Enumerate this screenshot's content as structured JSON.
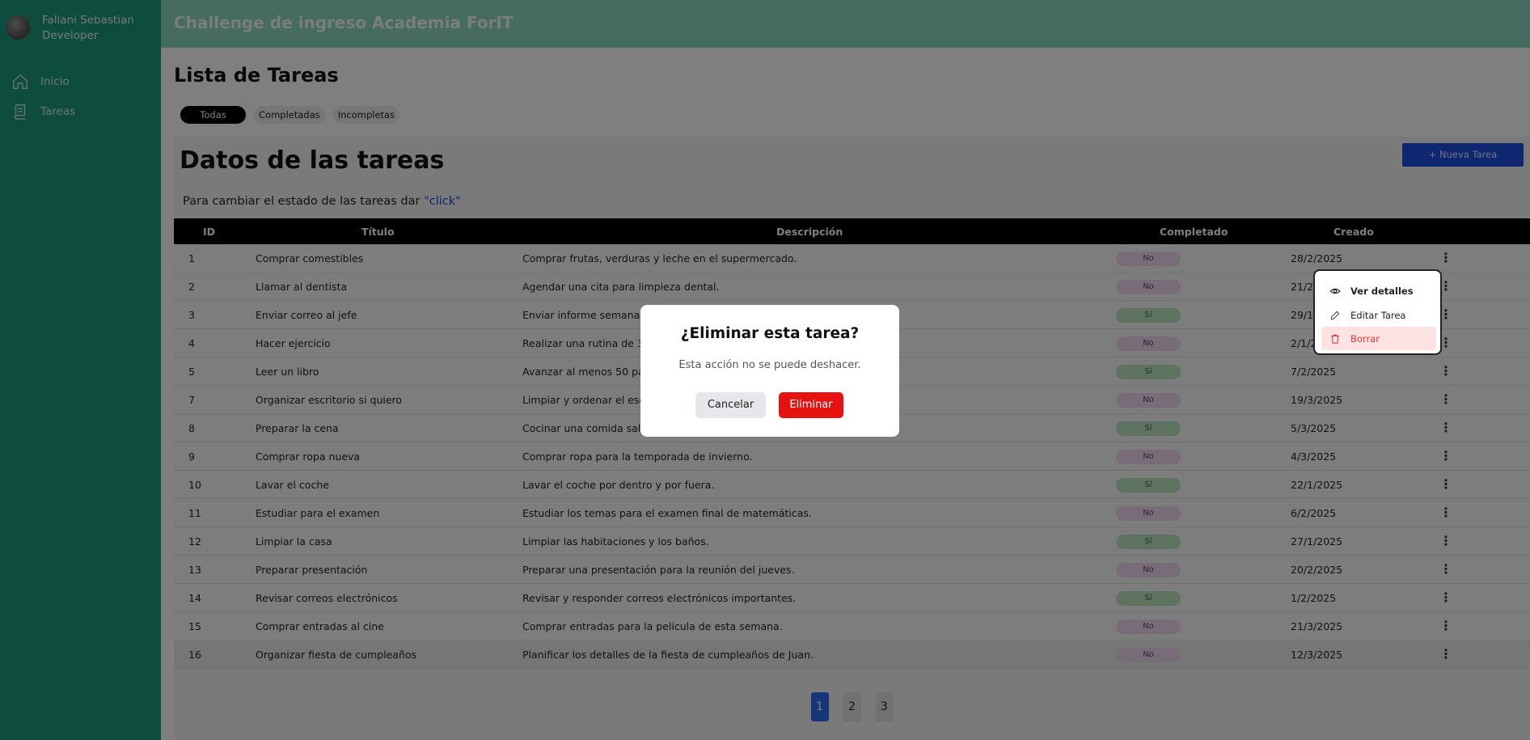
{
  "sidebar": {
    "user_name": "Faliani Sebastian",
    "user_role": "Developer",
    "items": [
      {
        "label": "Inicio",
        "icon": "home-icon"
      },
      {
        "label": "Tareas",
        "icon": "document-icon"
      }
    ]
  },
  "header": {
    "title": "Challenge de ingreso Academia ForIT"
  },
  "page": {
    "title": "Lista de Tareas",
    "filters": [
      "Todas",
      "Completadas",
      "Incompletas"
    ]
  },
  "panel": {
    "title": "Datos de las tareas",
    "new_button": "+ Nueva Tarea",
    "hint_text": "Para cambiar el estado de las tareas dar ",
    "hint_highlight": "\"click\""
  },
  "table": {
    "headers": [
      "ID",
      "Título",
      "Descripción",
      "Completado",
      "Creado"
    ],
    "rows": [
      {
        "id": "1",
        "title": "Comprar comestibles",
        "desc": "Comprar frutas, verduras y leche en el supermercado.",
        "status": "No",
        "date": "28/2/2025"
      },
      {
        "id": "2",
        "title": "Llamar al dentista",
        "desc": "Agendar una cita para limpieza dental.",
        "status": "No",
        "date": "21/2/2025"
      },
      {
        "id": "3",
        "title": "Enviar correo al jefe",
        "desc": "Enviar informe semanal",
        "status": "Sí",
        "date": "29/1/2025"
      },
      {
        "id": "4",
        "title": "Hacer ejercicio",
        "desc": "Realizar una rutina de 30",
        "status": "No",
        "date": "2/1/2025"
      },
      {
        "id": "5",
        "title": "Leer un libro",
        "desc": "Avanzar al menos 50 pá",
        "status": "Sí",
        "date": "7/2/2025"
      },
      {
        "id": "7",
        "title": "Organizar escritorio si quiero",
        "desc": "Limpiar y ordenar el escr",
        "status": "No",
        "date": "19/3/2025"
      },
      {
        "id": "8",
        "title": "Preparar la cena",
        "desc": "Cocinar una comida saludable para la familia.",
        "status": "Sí",
        "date": "5/3/2025"
      },
      {
        "id": "9",
        "title": "Comprar ropa nueva",
        "desc": "Comprar ropa para la temporada de invierno.",
        "status": "No",
        "date": "4/3/2025"
      },
      {
        "id": "10",
        "title": "Lavar el coche",
        "desc": "Lavar el coche por dentro y por fuera.",
        "status": "Sí",
        "date": "22/1/2025"
      },
      {
        "id": "11",
        "title": "Estudiar para el examen",
        "desc": "Estudiar los temas para el examen final de matemáticas.",
        "status": "No",
        "date": "6/2/2025"
      },
      {
        "id": "12",
        "title": "Limpiar la casa",
        "desc": "Limpiar las habitaciones y los baños.",
        "status": "Sí",
        "date": "27/1/2025"
      },
      {
        "id": "13",
        "title": "Preparar presentación",
        "desc": "Preparar una presentación para la reunión del jueves.",
        "status": "No",
        "date": "20/2/2025"
      },
      {
        "id": "14",
        "title": "Revisar correos electrónicos",
        "desc": "Revisar y responder correos electrónicos importantes.",
        "status": "Sí",
        "date": "1/2/2025"
      },
      {
        "id": "15",
        "title": "Comprar entradas al cine",
        "desc": "Comprar entradas para la película de esta semana.",
        "status": "No",
        "date": "21/3/2025"
      },
      {
        "id": "16",
        "title": "Organizar fiesta de cumpleaños",
        "desc": "Planificar los detalles de la fiesta de cumpleaños de Juan.",
        "status": "No",
        "date": "12/3/2025"
      }
    ]
  },
  "pagination": [
    "1",
    "2",
    "3"
  ],
  "context_menu": {
    "view": "Ver detalles",
    "edit": "Editar Tarea",
    "delete": "Borrar"
  },
  "modal": {
    "title": "¿Eliminar esta tarea?",
    "message": "Esta acción no se puede deshacer.",
    "cancel": "Cancelar",
    "confirm": "Eliminar"
  },
  "colors": {
    "sidebar": "#1d9a7a",
    "header": "#8cd6c1",
    "primary": "#1d4ee0",
    "danger": "#e61212"
  }
}
